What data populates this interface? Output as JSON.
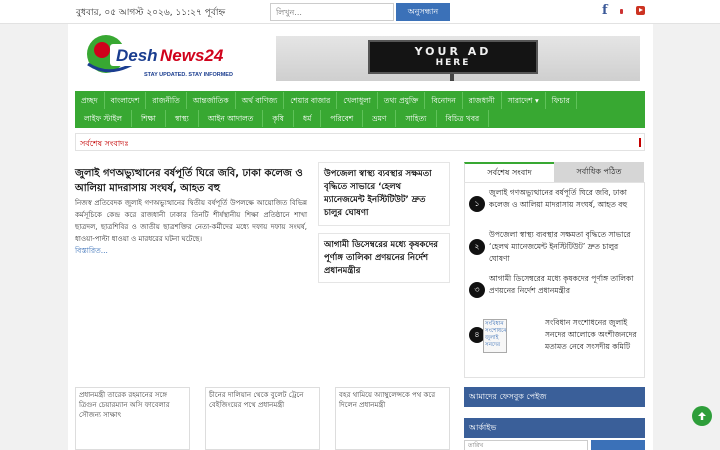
{
  "topbar": {
    "date": "বুধবার, ০৫ আগস্ট ২০২৬, ১১:২৭ পূর্বাহ্ন",
    "search_placeholder": "লিখুন...",
    "search_button": "অনুসন্ধান",
    "social": [
      "facebook-icon",
      "twitter-icon",
      "youtube-icon"
    ],
    "facebook_glyph": "f"
  },
  "brand": {
    "name_prefix": "Desh",
    "name_suffix": "News24",
    "tagline": "STAY UPDATED. STAY INFORMED",
    "colors": {
      "green": "#38a832",
      "red": "#d0021b",
      "blue": "#1a3d8f"
    }
  },
  "ad": {
    "line1": "YOUR AD",
    "line2": "HERE"
  },
  "nav": {
    "row1": [
      "প্রচ্ছদ",
      "বাংলাদেশ",
      "রাজনীতি",
      "আন্তর্জাতিক",
      "অর্থ বাণিজ্য",
      "শেয়ার বাজার",
      "খেলাধুলা",
      "তথ্য প্রযুক্তি",
      "বিনোদন",
      "রাজধানী",
      "সারাদেশ ▾",
      "ফিচার"
    ],
    "row2": [
      "লাইফ স্টাইল",
      "শিক্ষা",
      "স্বাস্থ্য",
      "আইন আদালত",
      "কৃষি",
      "ধর্ম",
      "পরিবেশ",
      "ভ্রমণ",
      "সাহিত্য",
      "বিচিত্র খবর"
    ]
  },
  "ticker": {
    "label": "সর্বশেষ সংবাদঃ"
  },
  "lead": {
    "title": "জুলাই গণঅভ্যুত্থানের বর্ষপূর্তি ঘিরে জবি, ঢাকা কলেজ ও আলিয়া মাদরাসায় সংঘর্ষ, আহত বহু",
    "excerpt": "নিজস্ব প্রতিবেদক জুলাই গণঅভ্যুত্থানের দ্বিতীয় বর্ষপূর্তি উপলক্ষে আয়োজিত বিভিন্ন কর্মসূচিকে কেন্দ্র করে রাজধানী ঢাকার তিনটি শীর্ষস্থানীয় শিক্ষা প্রতিষ্ঠানে শাখা ছাত্রদল, ছাত্রশিবির ও জাতীয় ছাত্রশক্তির নেতা-কর্মীদের মধ্যে দফায় দফায় সংঘর্ষ, ধাওয়া-পাল্টা ধাওয়া ও মারধরের ঘটনা ঘটেছে।",
    "read_more": "বিস্তারিত..."
  },
  "mid_stories": [
    "উপজেলা স্বাস্থ্য ব্যবস্থার সক্ষমতা বৃদ্ধিতে সাভারে ‘হেলথ ম্যানেজমেন্ট ইনস্টিটিউট’ দ্রুত চালুর ঘোষণা",
    "আগামী ডিসেম্বরের মধ্যে কৃষকদের পূর্ণাঙ্গ তালিকা প্রণয়নের নির্দেশ প্রধানমন্ত্রীর"
  ],
  "sidebar": {
    "tabs": [
      "সর্বশেষ সংবাদ",
      "সর্বাধিক পঠিত"
    ],
    "items": [
      {
        "num": "১",
        "text": "জুলাই গণঅভ্যুত্থানের বর্ষপূর্তি ঘিরে জবি, ঢাকা কলেজ ও আলিয়া মাদরাসায় সংঘর্ষ, আহত বহু"
      },
      {
        "num": "২",
        "text": "উপজেলা স্বাস্থ্য ব্যবস্থার সক্ষমতা বৃদ্ধিতে সাভারে ‘হেলথ ম্যানেজমেন্ট ইনস্টিটিউট’ দ্রুত চালুর ঘোষণা"
      },
      {
        "num": "৩",
        "text": "আগামী ডিসেম্বরের মধ্যে কৃষকদের পূর্ণাঙ্গ তালিকা প্রণয়নের নির্দেশ প্রধানমন্ত্রীর"
      },
      {
        "num": "৪",
        "text": "সংবিধান সংশোধনের জুলাই সনদের আলোকে অংশীজনদের মতামত নেবে সংসদীয় কমিটি",
        "thumb_alt": "সংবিধান সংশোধনের জুলাই সনদের"
      }
    ]
  },
  "bottom_thumbs": [
    "প্রধানমন্ত্রী তারেক রহমানের সঙ্গে ত্রিগুন চেয়ারম্যান অসি ফাবেলার সৌজন্য সাক্ষাৎ",
    "চীনের দালিয়ান থেকে বুলেট ট্রেনে বেইজিংয়ের পথে প্রধানমন্ত্রী",
    "বহর থামিয়ে অ্যাম্বুলেন্সকে পথ করে দিলেন প্রধানমন্ত্রী"
  ],
  "widgets": {
    "facebook_title": "আমাদের ফেসবুক পেইজ",
    "archive_title": "আর্কাইভ",
    "archive_placeholder": "তারিখ"
  }
}
